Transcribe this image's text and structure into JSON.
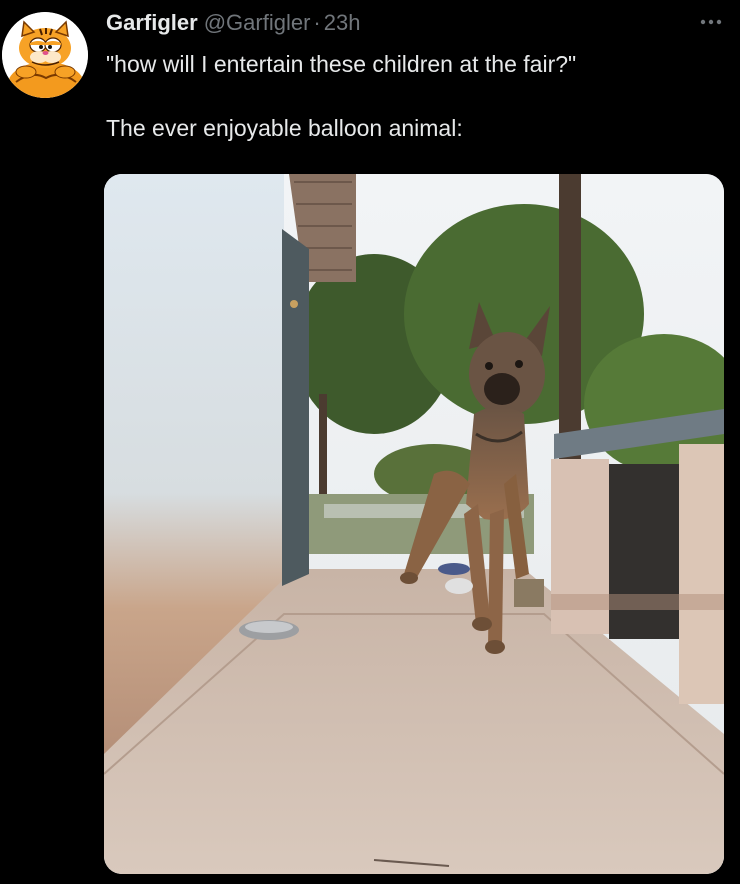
{
  "tweet": {
    "author": {
      "display_name": "Garfigler",
      "handle": "@Garfigler",
      "separator": "·",
      "time": "23h",
      "avatar_icon": "garfield-avatar-icon"
    },
    "more_icon": "more-horizontal-icon",
    "text": {
      "line1": "\"how will I entertain these children at the fair?\"",
      "line2": "The ever enjoyable balloon animal:"
    },
    "media": {
      "type": "photo"
    }
  },
  "colors": {
    "background": "#000000",
    "primary_text": "#e7e9ea",
    "secondary_text": "#71767b",
    "avatar_orange": "#f39a1e"
  }
}
